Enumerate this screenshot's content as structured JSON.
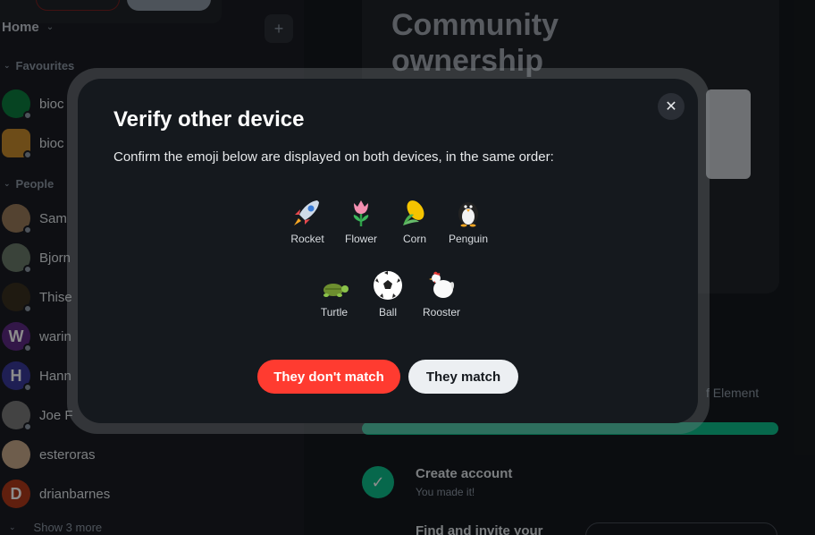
{
  "sidebar": {
    "home_label": "Home",
    "favourites_label": "Favourites",
    "people_label": "People",
    "favourites": [
      {
        "name": "bioc",
        "color": "#0b7d3e"
      },
      {
        "name": "bioc",
        "color": "#c78a2d"
      }
    ],
    "people": [
      {
        "name": "Sam",
        "initial": "",
        "color": "#9a7a5a"
      },
      {
        "name": "Bjorn",
        "initial": "",
        "color": "#6a7a6a"
      },
      {
        "name": "Thise",
        "initial": "",
        "color": "#3a3020"
      },
      {
        "name": "warin",
        "initial": "W",
        "color": "#5e2a84"
      },
      {
        "name": "Hann",
        "initial": "H",
        "color": "#3a3a9a"
      },
      {
        "name": "Joe F",
        "initial": "",
        "color": "#7a7a7a"
      },
      {
        "name": "esteroras",
        "initial": "",
        "color": "#c9a98a"
      },
      {
        "name": "drianbarnes",
        "initial": "D",
        "color": "#b03a1a"
      }
    ],
    "show_more": "Show 3 more"
  },
  "main": {
    "card_title": "Community ownership",
    "right_text": "f Element",
    "task1_title": "Create account",
    "task1_sub": "You made it!",
    "task2_title": "Find and invite your"
  },
  "dialog": {
    "title": "Verify other device",
    "description": "Confirm the emoji below are displayed on both devices, in the same order:",
    "emojis": [
      {
        "glyph": "🚀",
        "label": "Rocket"
      },
      {
        "glyph": "🌷",
        "label": "Flower"
      },
      {
        "glyph": "🌽",
        "label": "Corn"
      },
      {
        "glyph": "🐧",
        "label": "Penguin"
      },
      {
        "glyph": "🐢",
        "label": "Turtle"
      },
      {
        "glyph": "⚽",
        "label": "Ball"
      },
      {
        "glyph": "🐓",
        "label": "Rooster"
      }
    ],
    "no_match_label": "They don't match",
    "match_label": "They match",
    "close_icon": "close-icon"
  },
  "colors": {
    "accent_green": "#0dbd8b",
    "danger_red": "#ff3b30",
    "dialog_bg": "#15191e"
  }
}
